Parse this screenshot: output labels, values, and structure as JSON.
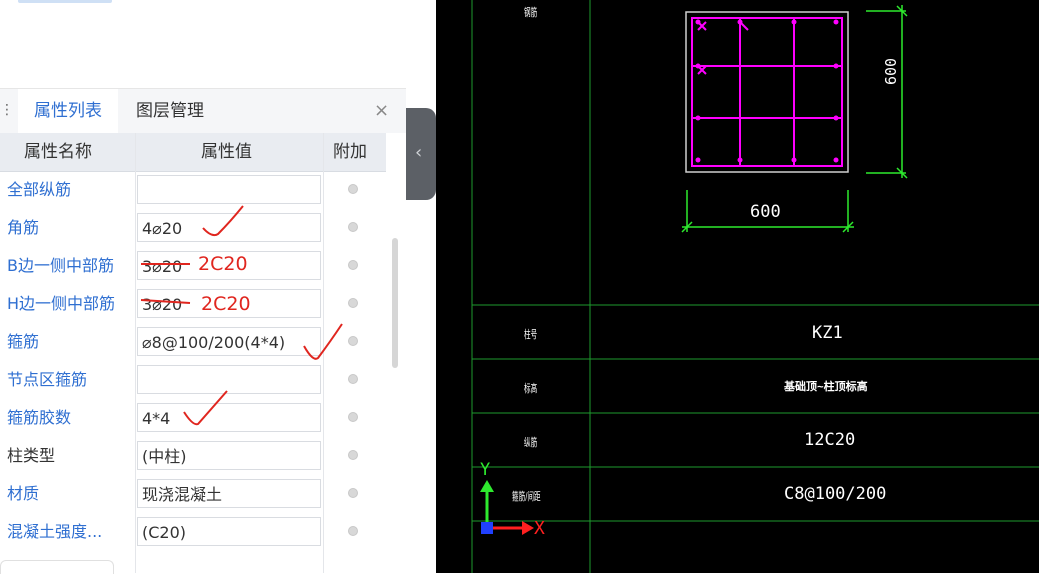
{
  "panel": {
    "tabs": [
      {
        "label": "属性列表",
        "active": true
      },
      {
        "label": "图层管理",
        "active": false
      }
    ],
    "close_icon": "×",
    "columns": [
      "属性名称",
      "属性值",
      "附加"
    ],
    "rows": [
      {
        "name": "全部纵筋",
        "value": "",
        "color": "blue"
      },
      {
        "name": "角筋",
        "value": "4⌀20",
        "color": "blue"
      },
      {
        "name": "B边一侧中部筋",
        "value": "3⌀20",
        "color": "blue"
      },
      {
        "name": "H边一侧中部筋",
        "value": "3⌀20",
        "color": "blue"
      },
      {
        "name": "箍筋",
        "value": "⌀8@100/200(4*4)",
        "color": "blue"
      },
      {
        "name": "节点区箍筋",
        "value": "",
        "color": "blue"
      },
      {
        "name": "箍筋胶数",
        "value": "4*4",
        "color": "blue"
      },
      {
        "name": "柱类型",
        "value": "(中柱)",
        "color": "dark"
      },
      {
        "name": "材质",
        "value": "现浇混凝土",
        "color": "blue"
      },
      {
        "name": "混凝土强度...",
        "value": "(C20)",
        "color": "blue"
      }
    ]
  },
  "annotations": {
    "b_edge": "2C20",
    "h_edge": "2C20"
  },
  "cad": {
    "dim_vertical": "600",
    "dim_horizontal": "600",
    "table": {
      "labels": [
        "柱号",
        "标高",
        "纵筋",
        "箍筋/间距"
      ],
      "row_values": [
        "KZ1",
        "基础顶~柱顶标高",
        "12C20",
        "C8@100/200"
      ]
    },
    "axis": {
      "y": "Y",
      "x": "X"
    },
    "colors": {
      "background": "#000000",
      "section": "#ff00ff",
      "dimension": "#00ff00",
      "table_line": "#00a000"
    }
  }
}
